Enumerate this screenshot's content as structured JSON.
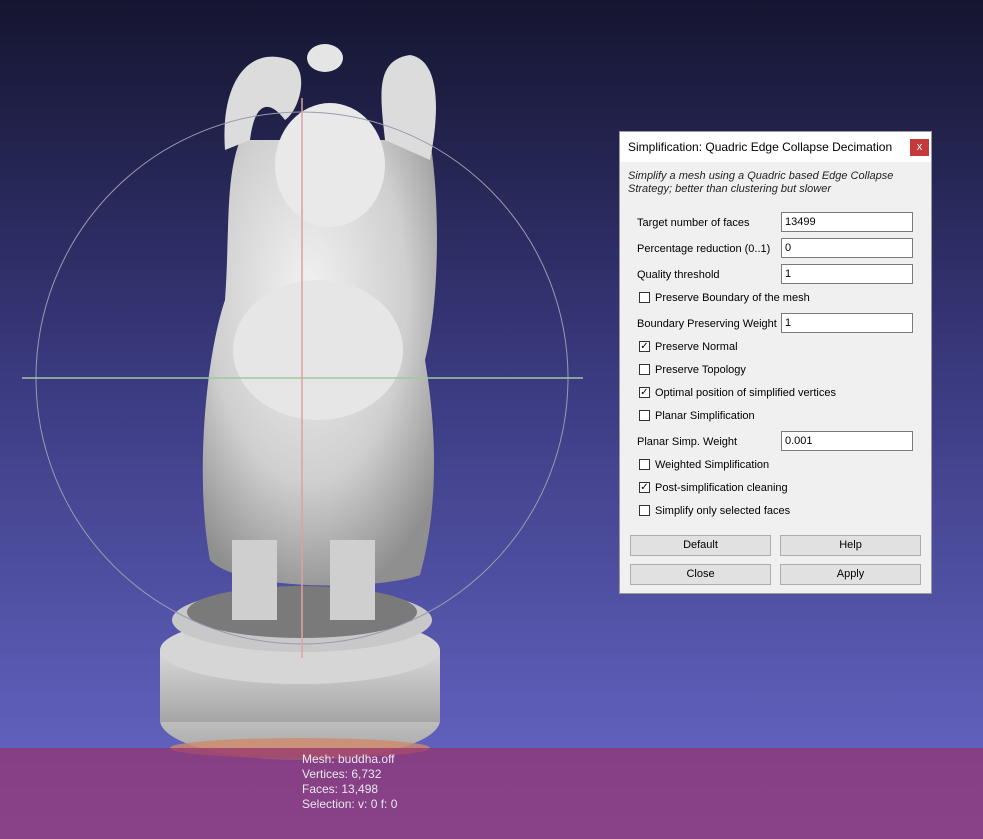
{
  "viewport": {
    "info": {
      "mesh": "Mesh: buddha.off",
      "vertices": "Vertices: 6,732",
      "faces": "Faces: 13,498",
      "selection": "Selection: v: 0 f: 0"
    }
  },
  "dialog": {
    "title": "Simplification: Quadric Edge Collapse Decimation",
    "close_glyph": "x",
    "description": "Simplify a mesh using a Quadric based Edge Collapse Strategy; better than clustering but slower",
    "fields": {
      "target_faces": {
        "label": "Target number of faces",
        "value": "13499"
      },
      "percentage_reduction": {
        "label": "Percentage reduction (0..1)",
        "value": "0"
      },
      "quality_threshold": {
        "label": "Quality threshold",
        "value": "1"
      },
      "boundary_weight": {
        "label": "Boundary Preserving Weight",
        "value": "1"
      },
      "planar_weight": {
        "label": "Planar Simp. Weight",
        "value": "0.001"
      }
    },
    "checks": {
      "preserve_boundary": {
        "label": "Preserve Boundary of the mesh",
        "checked": false
      },
      "preserve_normal": {
        "label": "Preserve Normal",
        "checked": true
      },
      "preserve_topology": {
        "label": "Preserve Topology",
        "checked": false
      },
      "optimal_position": {
        "label": "Optimal position of simplified vertices",
        "checked": true
      },
      "planar_simplification": {
        "label": "Planar Simplification",
        "checked": false
      },
      "weighted_simplification": {
        "label": "Weighted Simplification",
        "checked": false
      },
      "post_cleaning": {
        "label": "Post-simplification cleaning",
        "checked": true
      },
      "only_selected": {
        "label": "Simplify only selected faces",
        "checked": false
      }
    },
    "buttons": {
      "default": "Default",
      "help": "Help",
      "close": "Close",
      "apply": "Apply"
    },
    "check_glyph": "✓"
  }
}
